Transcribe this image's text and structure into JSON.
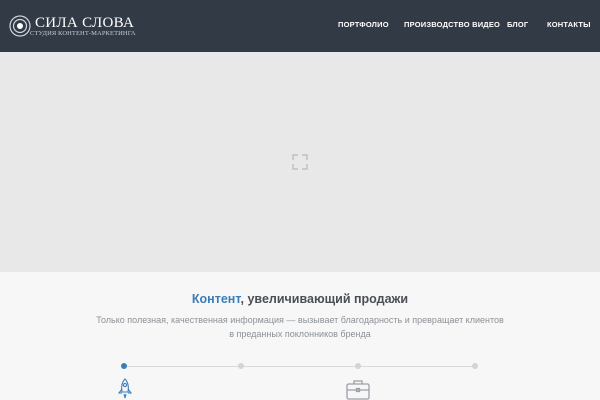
{
  "header": {
    "brand_title": "СИЛА СЛОВА",
    "brand_subtitle": "СТУДИЯ КОНТЕНТ-МАРКЕТИНГА",
    "logo_icon": "concentric-circles-icon",
    "nav": [
      {
        "label": "ПОРТФОЛИО"
      },
      {
        "label": "ПРОИЗВОДСТВО ВИДЕО"
      },
      {
        "label": "БЛОГ"
      },
      {
        "label": "КОНТАКТЫ"
      }
    ]
  },
  "hero": {
    "icon": "expand-icon"
  },
  "section": {
    "heading_accent": "Контент",
    "heading_rest": ", увеличивающий продажи",
    "subtext_line1": "Только полезная, качественная информация — вызывает благодарность и превращает клиентов",
    "subtext_line2": "в преданных поклонников бренда",
    "steps": [
      {
        "active": true,
        "icon": "rocket-icon"
      },
      {
        "active": false
      },
      {
        "active": false,
        "icon": "briefcase-icon"
      },
      {
        "active": false
      }
    ]
  },
  "colors": {
    "header_bg": "#323a45",
    "accent": "#3a7db8",
    "hero_bg": "#e8e8e8",
    "page_bg": "#f7f7f7"
  }
}
